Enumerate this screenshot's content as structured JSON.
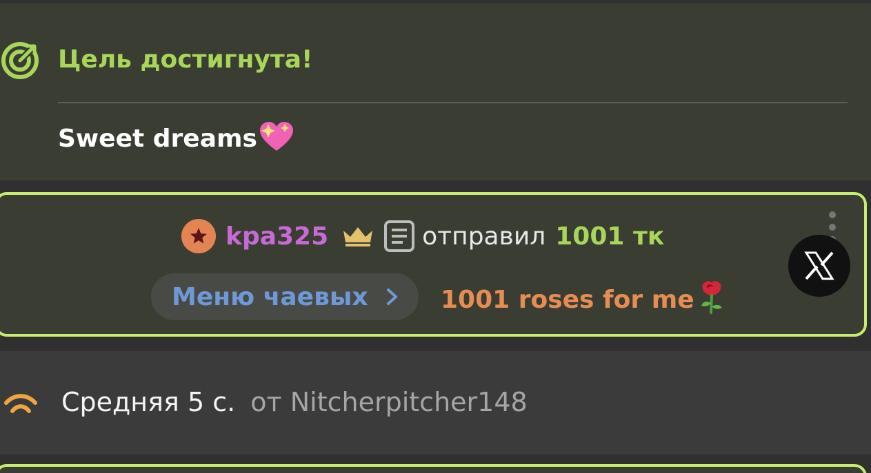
{
  "goal": {
    "title": "Цель достигнута!",
    "message": "Sweet dreams",
    "emoji": "💖",
    "icon": "target-icon",
    "accent_color": "#a7d65a"
  },
  "tip": {
    "username": "kpa325",
    "sent_label": "отправил",
    "amount": "1001 тк",
    "menu_label": "Меню чаевых",
    "note": "1001 roses for me",
    "note_emoji": "🌹",
    "username_color": "#c66bd6",
    "amount_color": "#a7d65a",
    "note_color": "#e58d55",
    "border_color": "#c6ed6f"
  },
  "activity": {
    "main": "Средняя 5 с.",
    "from": "от Nitcherpitcher148",
    "icon": "wave-icon"
  },
  "icons": {
    "avatar": "star-avatar-icon",
    "crown": "crown-icon",
    "document": "document-icon",
    "more": "more-vertical-icon",
    "close": "x-icon",
    "chevron": "chevron-right-icon"
  }
}
